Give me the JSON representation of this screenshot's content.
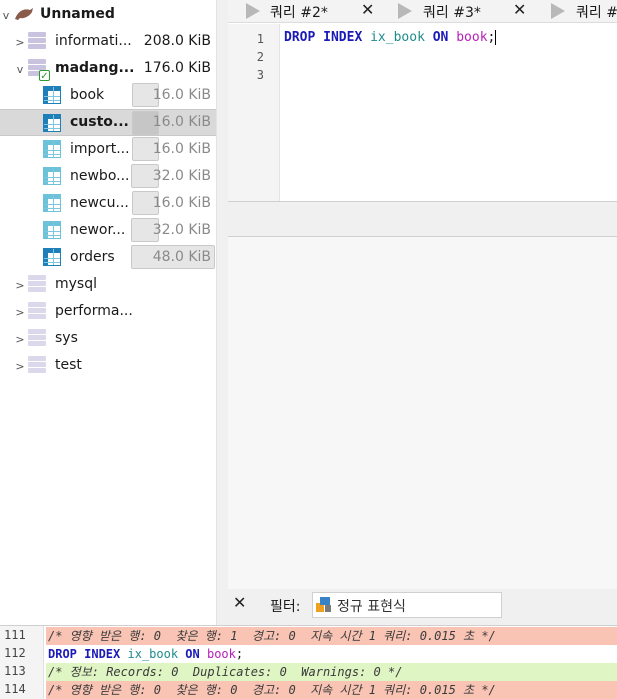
{
  "tree": {
    "root": {
      "label": "Unnamed",
      "icon": "dolphin-icon"
    },
    "databases": [
      {
        "label": "informati...",
        "size": "208.0 KiB",
        "expanded": false
      },
      {
        "label": "madang...",
        "size": "176.0 KiB",
        "expanded": true,
        "tables": [
          {
            "label": "book",
            "size": "16.0 KiB"
          },
          {
            "label": "custo...",
            "size": "16.0 KiB",
            "selected": true
          },
          {
            "label": "import...",
            "size": "16.0 KiB"
          },
          {
            "label": "newbo...",
            "size": "32.0 KiB"
          },
          {
            "label": "newcu...",
            "size": "16.0 KiB"
          },
          {
            "label": "newor...",
            "size": "32.0 KiB"
          },
          {
            "label": "orders",
            "size": "48.0 KiB"
          }
        ]
      },
      {
        "label": "mysql"
      },
      {
        "label": "performa..."
      },
      {
        "label": "sys"
      },
      {
        "label": "test"
      }
    ]
  },
  "tabs": [
    {
      "label": "쿼리 #2*"
    },
    {
      "label": "쿼리 #3*"
    },
    {
      "label": "쿼리 #"
    }
  ],
  "editor": {
    "line_numbers": [
      "1",
      "2",
      "3"
    ],
    "code": {
      "kw1": "DROP INDEX",
      "ident": "ix_book",
      "kw2": "ON",
      "table": "book",
      "end": ";"
    }
  },
  "filter": {
    "close": "✕",
    "label": "필터:",
    "placeholder": "정규 표현식"
  },
  "log": [
    {
      "line": "111",
      "text": "/* 영향 받은 행: 0  찾은 행: 1  경고: 0  지속 시간 1 쿼리: 0.015 초 */",
      "kind": "bad"
    },
    {
      "line": "112",
      "text": "DROP INDEX ix_book ON book;",
      "kind": "plain"
    },
    {
      "line": "113",
      "text": "/* 정보: Records: 0  Duplicates: 0  Warnings: 0 */",
      "kind": "info"
    },
    {
      "line": "114",
      "text": "/* 영향 받은 행: 0  찾은 행: 0  경고: 0  지속 시간 1 쿼리: 0.015 초 */",
      "kind": "bad"
    }
  ],
  "colors": {
    "selected_row": "#d9d9d9",
    "keyword": "#1a1ab8",
    "table_name": "#b81fb8",
    "log_warning": "#f9c4b4",
    "log_info": "#e0f5c4"
  }
}
